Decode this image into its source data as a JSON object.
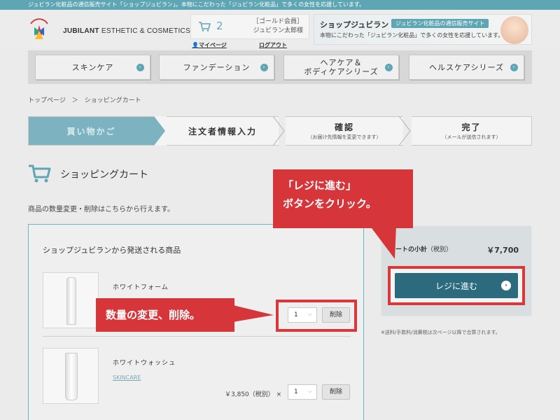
{
  "topbar": {
    "text": "ジュビラン化粧品の通信販売サイト「ショップジュビラン」。本物にこだわった「ジュビラン化粧品」で多くの女性を応援しています。"
  },
  "header": {
    "brand_bold": "JUBILANT",
    "brand_rest": " ESTHETIC & COSMETICS",
    "cart_count": "2",
    "rank": "［ゴールド会員］",
    "user": "ジュビラン太郎様",
    "mypage": "マイページ",
    "logout": "ログアウト"
  },
  "banner": {
    "title": "ショップジュビラン",
    "badge": "ジュビラン化粧品の通信販売サイト",
    "sub": "本物にこだわった「ジュビラン化粧品」で多くの女性を応援しています。"
  },
  "nav": {
    "items": [
      {
        "label": "スキンケア"
      },
      {
        "label": "ファンデーション"
      },
      {
        "label": "ヘアケア＆\nボディケアシリーズ"
      },
      {
        "label": "ヘルスケアシリーズ"
      }
    ]
  },
  "breadcrumb": {
    "home": "トップページ",
    "sep": "＞",
    "current": "ショッピングカート"
  },
  "steps": [
    {
      "title": "買い物かご",
      "sub": ""
    },
    {
      "title": "注文者情報入力",
      "sub": ""
    },
    {
      "title": "確認",
      "sub": "（お届け先情報を変更できます）"
    },
    {
      "title": "完了",
      "sub": "（メールが送信されます）"
    }
  ],
  "page": {
    "title": "ショッピングカート",
    "note": "商品の数量変更・削除はこちらから行えます。"
  },
  "itembox": {
    "title": "ショップジュビランから発送される商品",
    "products": [
      {
        "name": "ホワイトフォーム",
        "category": "",
        "price": "",
        "qty": "1",
        "delete": "削除"
      },
      {
        "name": "ホワイトウォッシュ",
        "category": "SKINCARE",
        "price": "￥3,850（税別） ×",
        "qty": "1",
        "delete": "削除"
      }
    ]
  },
  "summary": {
    "label": "ートの小計",
    "label_tax": "（税別）",
    "value": "￥7,700",
    "checkout": "レジに進む",
    "fine": "※送料/手数料/消費税は次ページ以降で合算されます。"
  },
  "callouts": {
    "checkout_line1": "「レジに進む」",
    "checkout_line2": "ボタンをクリック。",
    "qty": "数量の変更、削除。"
  },
  "colors": {
    "accent": "#5fa6b4",
    "button": "#2b6b7d",
    "callout": "#d6363a"
  }
}
